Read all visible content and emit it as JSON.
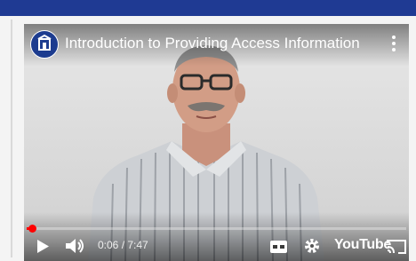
{
  "player": {
    "title": "Introduction to Providing Access Information",
    "time_display": "0:06 / 7:47",
    "progress_fraction": 0.013,
    "brand": "YouTube"
  },
  "icons": {
    "channel": "channel-logo-icon",
    "more": "more-vertical-icon",
    "play": "play-icon",
    "volume": "volume-icon",
    "captions": "captions-icon",
    "settings": "gear-icon",
    "cast": "cast-icon"
  },
  "colors": {
    "top_band": "#1f3a93",
    "progress": "#ff0000",
    "channel_logo": "#1d3c8f"
  }
}
